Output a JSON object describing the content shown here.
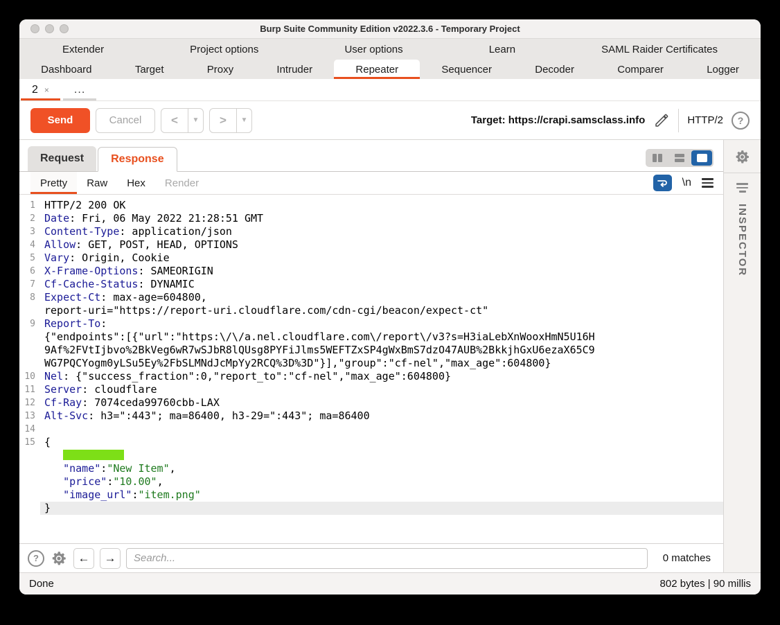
{
  "window": {
    "title": "Burp Suite Community Edition v2022.3.6 - Temporary Project",
    "status_left": "Done",
    "status_right": "802 bytes | 90 millis"
  },
  "menu": {
    "row1": [
      {
        "label": "Extender"
      },
      {
        "label": "Project options"
      },
      {
        "label": "User options"
      },
      {
        "label": "Learn"
      },
      {
        "label": "SAML Raider Certificates"
      }
    ],
    "row2": [
      {
        "label": "Dashboard"
      },
      {
        "label": "Target"
      },
      {
        "label": "Proxy"
      },
      {
        "label": "Intruder"
      },
      {
        "label": "Repeater",
        "selected": true
      },
      {
        "label": "Sequencer"
      },
      {
        "label": "Decoder"
      },
      {
        "label": "Comparer"
      },
      {
        "label": "Logger"
      }
    ]
  },
  "session_tabs": {
    "tab_label": "2",
    "more_label": "..."
  },
  "toolbar": {
    "send_label": "Send",
    "cancel_label": "Cancel",
    "target_label": "Target: https://crapi.samsclass.info",
    "http_version": "HTTP/2",
    "help_glyph": "?"
  },
  "message_tabs": {
    "request": "Request",
    "response": "Response"
  },
  "view_tabs": {
    "pretty": "Pretty",
    "raw": "Raw",
    "hex": "Hex",
    "render": "Render",
    "newline_label": "\\n"
  },
  "editor": {
    "lines": [
      {
        "num": "1",
        "segs": [
          [
            "p",
            "HTTP/2 200 OK"
          ]
        ]
      },
      {
        "num": "2",
        "segs": [
          [
            "h",
            "Date"
          ],
          [
            "p",
            ": Fri, 06 May 2022 21:28:51 GMT"
          ]
        ]
      },
      {
        "num": "3",
        "segs": [
          [
            "h",
            "Content-Type"
          ],
          [
            "p",
            ": application/json"
          ]
        ]
      },
      {
        "num": "4",
        "segs": [
          [
            "h",
            "Allow"
          ],
          [
            "p",
            ": GET, POST, HEAD, OPTIONS"
          ]
        ]
      },
      {
        "num": "5",
        "segs": [
          [
            "h",
            "Vary"
          ],
          [
            "p",
            ": Origin, Cookie"
          ]
        ]
      },
      {
        "num": "6",
        "segs": [
          [
            "h",
            "X-Frame-Options"
          ],
          [
            "p",
            ": SAMEORIGIN"
          ]
        ]
      },
      {
        "num": "7",
        "segs": [
          [
            "h",
            "Cf-Cache-Status"
          ],
          [
            "p",
            ": DYNAMIC"
          ]
        ]
      },
      {
        "num": "8",
        "segs": [
          [
            "h",
            "Expect-Ct"
          ],
          [
            "p",
            ": max-age=604800,"
          ]
        ]
      },
      {
        "num": "",
        "segs": [
          [
            "p",
            "report-uri=\"https://report-uri.cloudflare.com/cdn-cgi/beacon/expect-ct\""
          ]
        ]
      },
      {
        "num": "9",
        "segs": [
          [
            "h",
            "Report-To"
          ],
          [
            "p",
            ":"
          ]
        ]
      },
      {
        "num": "",
        "segs": [
          [
            "p",
            "{\"endpoints\":[{\"url\":\"https:\\/\\/a.nel.cloudflare.com\\/report\\/v3?s=H3iaLebXnWooxHmN5U16H"
          ]
        ]
      },
      {
        "num": "",
        "segs": [
          [
            "p",
            "9Af%2FVtIjbvo%2BkVeg6wR7wSJbR8lQUsg8PYFiJlms5WEFTZxSP4gWxBmS7dzO47AUB%2BkkjhGxU6ezaX65C9"
          ]
        ]
      },
      {
        "num": "",
        "segs": [
          [
            "p",
            "WG7PQCYogm0yLSu5Ey%2FbSLMNdJcMpYy2RCQ%3D%3D\"}],\"group\":\"cf-nel\",\"max_age\":604800}"
          ]
        ]
      },
      {
        "num": "10",
        "segs": [
          [
            "h",
            "Nel"
          ],
          [
            "p",
            ": {\"success_fraction\":0,\"report_to\":\"cf-nel\",\"max_age\":604800}"
          ]
        ]
      },
      {
        "num": "11",
        "segs": [
          [
            "h",
            "Server"
          ],
          [
            "p",
            ": cloudflare"
          ]
        ]
      },
      {
        "num": "12",
        "segs": [
          [
            "h",
            "Cf-Ray"
          ],
          [
            "p",
            ": 7074ceda99760cbb-LAX"
          ]
        ]
      },
      {
        "num": "13",
        "segs": [
          [
            "h",
            "Alt-Svc"
          ],
          [
            "p",
            ": h3=\":443\"; ma=86400, h3-29=\":443\"; ma=86400"
          ]
        ]
      },
      {
        "num": "14",
        "segs": []
      },
      {
        "num": "15",
        "segs": [
          [
            "p",
            "{"
          ]
        ]
      },
      {
        "num": "",
        "block": true,
        "segs": []
      },
      {
        "num": "",
        "segs": [
          [
            "p",
            "   "
          ],
          [
            "h",
            "\"name\""
          ],
          [
            "p",
            ":"
          ],
          [
            "g",
            "\"New Item\""
          ],
          [
            "p",
            ","
          ]
        ]
      },
      {
        "num": "",
        "segs": [
          [
            "p",
            "   "
          ],
          [
            "h",
            "\"price\""
          ],
          [
            "p",
            ":"
          ],
          [
            "g",
            "\"10.00\""
          ],
          [
            "p",
            ","
          ]
        ]
      },
      {
        "num": "",
        "segs": [
          [
            "p",
            "   "
          ],
          [
            "h",
            "\"image_url\""
          ],
          [
            "p",
            ":"
          ],
          [
            "g",
            "\"item.png\""
          ]
        ]
      },
      {
        "num": "",
        "cursor": true,
        "segs": [
          [
            "p",
            "}"
          ]
        ]
      }
    ]
  },
  "search": {
    "placeholder": "Search...",
    "matches": "0 matches"
  },
  "inspector": {
    "label": "INSPECTOR"
  },
  "colors": {
    "accent_orange": "#e8501f",
    "send_button": "#f05126",
    "selection_green": "#7ddf17",
    "header_name_blue": "#1a1a96",
    "json_value_green": "#1e7a1e",
    "view_button_blue": "#2263a7"
  }
}
